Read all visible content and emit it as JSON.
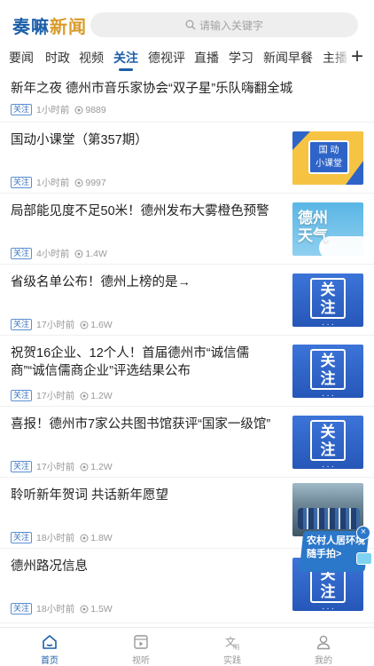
{
  "header": {
    "logo_a": "奏嘛",
    "logo_b": "新闻",
    "search_placeholder": "请输入关键字"
  },
  "tabs": [
    {
      "label": "要闻"
    },
    {
      "label": "时政"
    },
    {
      "label": "视频"
    },
    {
      "label": "关注",
      "active": true
    },
    {
      "label": "德视评"
    },
    {
      "label": "直播"
    },
    {
      "label": "学习"
    },
    {
      "label": "新闻早餐"
    },
    {
      "label": "主播"
    }
  ],
  "add_tab_icon": "plus-icon",
  "feed": [
    {
      "title": "新年之夜  德州市音乐家协会“双子星”乐队嗨翻全城",
      "tag": "关注",
      "time": "1小时前",
      "views": "9889",
      "thumb": null
    },
    {
      "title": "国动小课堂（第357期）",
      "tag": "关注",
      "time": "1小时前",
      "views": "9997",
      "thumb": "class",
      "thumb_text": [
        "国 动",
        "小课堂"
      ]
    },
    {
      "title": "局部能见度不足50米！德州发布大雾橙色预警",
      "tag": "关注",
      "time": "4小时前",
      "views": "1.4W",
      "thumb": "weather",
      "thumb_text": [
        "德州",
        "天气"
      ]
    },
    {
      "title": "省级名单公布！德州上榜的是→",
      "tag": "关注",
      "time": "17小时前",
      "views": "1.6W",
      "thumb": "focus",
      "thumb_text": [
        "关",
        "注"
      ]
    },
    {
      "title": "祝贺16企业、12个人！首届德州市“诚信儒商”“诚信儒商企业”评选结果公布",
      "tag": "关注",
      "time": "17小时前",
      "views": "1.2W",
      "thumb": "focus",
      "thumb_text": [
        "关",
        "注"
      ]
    },
    {
      "title": "喜报！德州市7家公共图书馆获评“国家一级馆”",
      "tag": "关注",
      "time": "17小时前",
      "views": "1.2W",
      "thumb": "focus",
      "thumb_text": [
        "关",
        "注"
      ]
    },
    {
      "title": "聆听新年贺词  共话新年愿望",
      "tag": "关注",
      "time": "18小时前",
      "views": "1.8W",
      "thumb": "photo"
    },
    {
      "title": "德州路况信息",
      "tag": "关注",
      "time": "18小时前",
      "views": "1.5W",
      "thumb": "focus",
      "thumb_text": [
        "关",
        "注"
      ]
    }
  ],
  "float_ad": {
    "line1": "农村人居环境",
    "line2": "随手拍>"
  },
  "bottom_nav": [
    {
      "label": "首页",
      "icon": "home-icon",
      "active": true
    },
    {
      "label": "视听",
      "icon": "video-icon"
    },
    {
      "label": "实践",
      "icon": "practice-icon"
    },
    {
      "label": "我的",
      "icon": "user-icon"
    }
  ],
  "colors": {
    "accent": "#1d5fa8",
    "logo_secondary": "#d89b2b",
    "tag": "#3b73bd"
  }
}
